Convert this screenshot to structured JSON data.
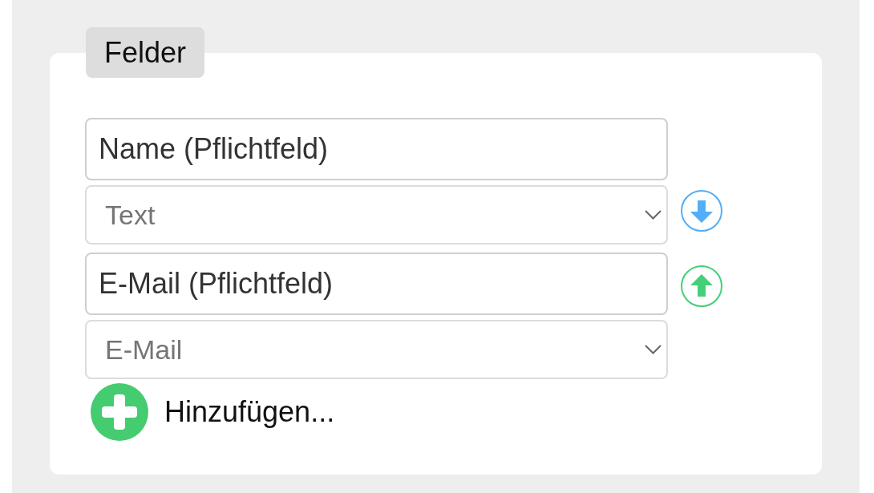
{
  "fieldset": {
    "legend": "Felder",
    "fields": [
      {
        "name": "Name (Pflichtfeld)",
        "type": "Text",
        "kind": "down"
      },
      {
        "name": "E-Mail (Pflichtfeld)",
        "type": "E-Mail",
        "kind": "up"
      }
    ],
    "add_button": {
      "label": "Hinzufügen..."
    }
  }
}
